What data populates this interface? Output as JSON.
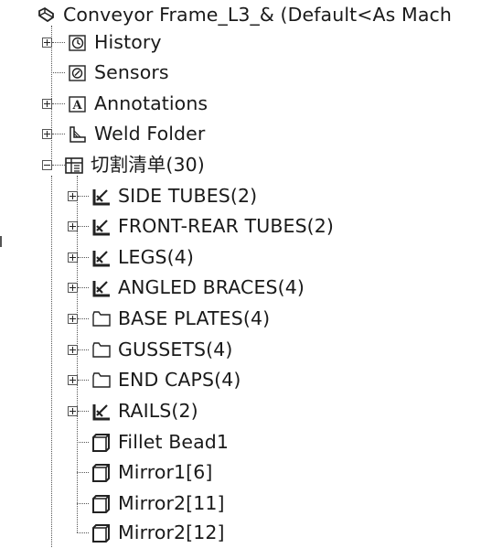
{
  "tree": {
    "root": {
      "label": "Conveyor Frame_L3_&  (Default<As Mach",
      "icon": "part-icon"
    },
    "top_items": [
      {
        "label": "History",
        "icon": "history-icon",
        "expander": "plus"
      },
      {
        "label": "Sensors",
        "icon": "sensors-icon",
        "expander": "none"
      },
      {
        "label": "Annotations",
        "icon": "annotations-icon",
        "expander": "plus"
      },
      {
        "label": "Weld Folder",
        "icon": "weld-folder-icon",
        "expander": "plus"
      },
      {
        "label": "切割清单(30)",
        "icon": "cut-list-icon",
        "expander": "minus"
      }
    ],
    "cut_list_items": [
      {
        "label": "SIDE TUBES(2)",
        "icon": "structural-member-icon",
        "expander": "plus"
      },
      {
        "label": "FRONT-REAR TUBES(2)",
        "icon": "structural-member-icon",
        "expander": "plus"
      },
      {
        "label": "LEGS(4)",
        "icon": "structural-member-icon",
        "expander": "plus"
      },
      {
        "label": "ANGLED BRACES(4)",
        "icon": "structural-member-icon",
        "expander": "plus"
      },
      {
        "label": "BASE PLATES(4)",
        "icon": "folder-icon",
        "expander": "plus"
      },
      {
        "label": "GUSSETS(4)",
        "icon": "folder-icon",
        "expander": "plus"
      },
      {
        "label": "END CAPS(4)",
        "icon": "folder-icon",
        "expander": "plus"
      },
      {
        "label": "RAILS(2)",
        "icon": "structural-member-icon",
        "expander": "plus"
      },
      {
        "label": "Fillet Bead1",
        "icon": "body-icon",
        "expander": "none"
      },
      {
        "label": "Mirror1[6]",
        "icon": "body-icon",
        "expander": "none"
      },
      {
        "label": "Mirror2[11]",
        "icon": "body-icon",
        "expander": "none"
      },
      {
        "label": "Mirror2[12]",
        "icon": "body-icon",
        "expander": "none"
      }
    ]
  }
}
